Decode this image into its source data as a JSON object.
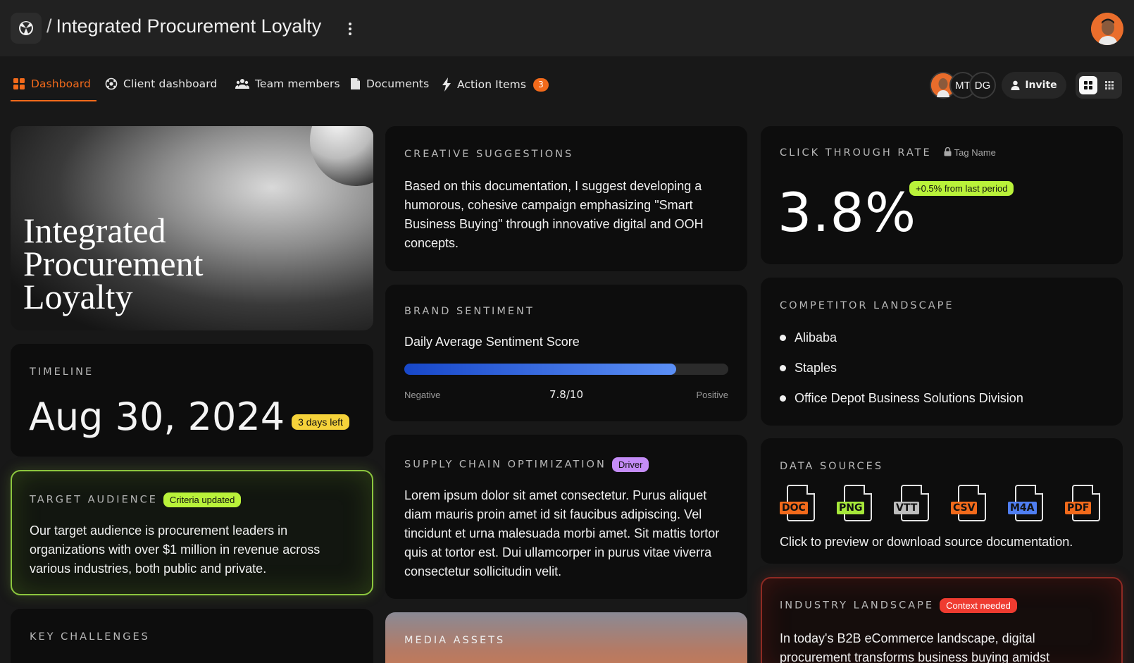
{
  "header": {
    "separator": "/",
    "title": "Integrated Procurement Loyalty"
  },
  "nav": {
    "tabs": [
      {
        "label": "Dashboard",
        "icon": "grid-icon",
        "active": true
      },
      {
        "label": "Client dashboard",
        "icon": "client-icon"
      },
      {
        "label": "Team members",
        "icon": "team-icon"
      },
      {
        "label": "Documents",
        "icon": "document-icon"
      },
      {
        "label": "Action Items",
        "icon": "lightning-icon",
        "badge": "3"
      }
    ],
    "avatars": [
      "MT",
      "DG"
    ],
    "invite_label": "Invite"
  },
  "colors": {
    "accent": "#f26a1b",
    "green": "#b9f23a",
    "yellow": "#f5d23a",
    "purple": "#c48cf7",
    "red": "#ef3b30"
  },
  "hero": {
    "title_line1": "Integrated",
    "title_line2": "Procurement",
    "title_line3": "Loyalty"
  },
  "timeline": {
    "label": "TIMELINE",
    "date": "Aug 30, 2024",
    "badge": "3 days left"
  },
  "target": {
    "label": "TARGET AUDIENCE",
    "badge": "Criteria updated",
    "text": "Our target audience is procurement leaders in organizations with over $1 million in revenue across various industries, both public and private."
  },
  "challenges": {
    "label": "KEY CHALLENGES"
  },
  "creative": {
    "label": "CREATIVE SUGGESTIONS",
    "text": "Based on this documentation, I suggest developing a humorous, cohesive campaign emphasizing \"Smart Business Buying\" through innovative digital and OOH concepts."
  },
  "brand": {
    "label": "BRAND SENTIMENT",
    "subtitle": "Daily Average Sentiment Score",
    "score_text": "7.8/10",
    "score_fraction": 0.84,
    "low_label": "Negative",
    "high_label": "Positive"
  },
  "supply": {
    "label": "SUPPLY CHAIN OPTIMIZATION",
    "badge": "Driver",
    "text": "Lorem ipsum dolor sit amet consectetur. Purus aliquet diam mauris proin amet id sit faucibus adipiscing. Vel tincidunt et urna malesuada morbi amet. Sit mattis tortor quis at tortor est. Dui ullamcorper in purus vitae viverra consectetur sollicitudin velit."
  },
  "media": {
    "label": "MEDIA ASSETS"
  },
  "ctr": {
    "label": "CLICK THROUGH RATE",
    "tag": "Tag Name",
    "value": "3.8%",
    "change": "+0.5% from last period"
  },
  "competitor": {
    "label": "COMPETITOR LANDSCAPE",
    "items": [
      "Alibaba",
      "Staples",
      "Office Depot Business Solutions Division"
    ]
  },
  "sources": {
    "label": "DATA SOURCES",
    "files": [
      {
        "type": "DOC",
        "color": "#f26a1b"
      },
      {
        "type": "PNG",
        "color": "#a6e83a"
      },
      {
        "type": "VTT",
        "color": "#bdbdbd"
      },
      {
        "type": "CSV",
        "color": "#f26a1b"
      },
      {
        "type": "M4A",
        "color": "#4f7ef2"
      },
      {
        "type": "PDF",
        "color": "#f26a1b"
      }
    ],
    "caption": "Click to preview or download source documentation."
  },
  "industry": {
    "label": "INDUSTRY LANDSCAPE",
    "badge": "Context needed",
    "text": "In today's B2B eCommerce landscape, digital procurement transforms business buying amidst"
  }
}
